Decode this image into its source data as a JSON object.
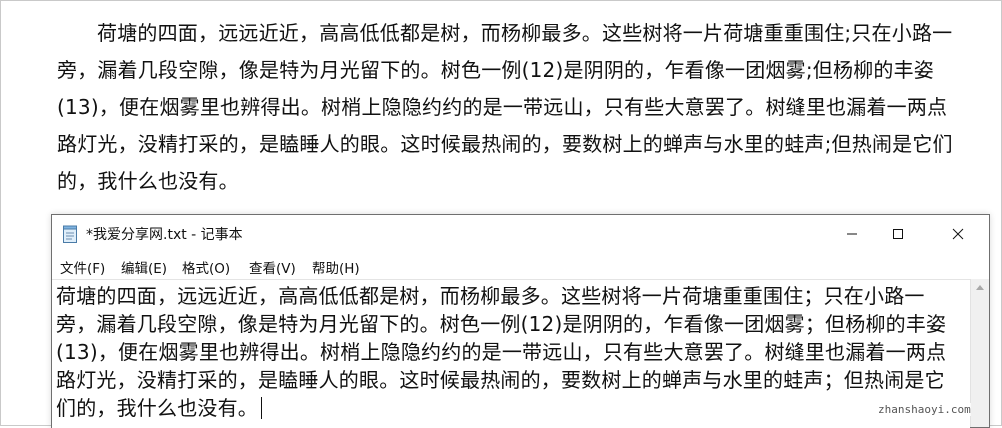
{
  "document": {
    "paragraph": "荷塘的四面，远远近近，高高低低都是树，而杨柳最多。这些树将一片荷塘重重围住;只在小路一旁，漏着几段空隙，像是特为月光留下的。树色一例(12)是阴阴的，乍看像一团烟雾;但杨柳的丰姿(13)，便在烟雾里也辨得出。树梢上隐隐约约的是一带远山，只有些大意罢了。树缝里也漏着一两点路灯光，没精打采的，是瞌睡人的眼。这时候最热闹的，要数树上的蝉声与水里的蛙声;但热闹是它们的，我什么也没有。"
  },
  "notepad": {
    "title": "*我爱分享网.txt - 记事本",
    "icon": "notepad-icon",
    "menu": [
      "文件(F)",
      "编辑(E)",
      "格式(O)",
      "查看(V)",
      "帮助(H)"
    ],
    "content": "荷塘的四面，远远近近，高高低低都是树，而杨柳最多。这些树将一片荷塘重重围住；只在小路一旁，漏着几段空隙，像是特为月光留下的。树色一例(12)是阴阴的，乍看像一团烟雾；但杨柳的丰姿(13)，便在烟雾里也辨得出。树梢上隐隐约约的是一带远山，只有些大意罢了。树缝里也漏着一两点路灯光，没精打采的，是瞌睡人的眼。这时候最热闹的，要数树上的蝉声与水里的蛙声；但热闹是它们的，我什么也没有。"
  },
  "watermark": "zhanshaoyi.com"
}
